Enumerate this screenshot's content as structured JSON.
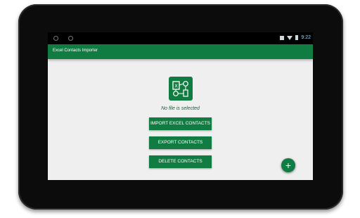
{
  "status_bar": {
    "time": "9:22",
    "left_icons": [
      "notification-icon",
      "notification-icon"
    ],
    "right_icons": [
      "sim-icon",
      "wifi-icon",
      "battery-icon"
    ]
  },
  "app_bar": {
    "title": "Excel Contacts Importer"
  },
  "main": {
    "logo_icon": "excel-contacts-logo-icon",
    "file_status": "No file is selected",
    "import_label": "IMPORT EXCEL CONTACTS",
    "export_label": "EXPORT CONTACTS",
    "delete_label": "DELETE CONTACTS"
  },
  "fab": {
    "symbol": "+",
    "icon": "add-icon"
  },
  "colors": {
    "accent": "#107c41",
    "screen_bg": "#efefef",
    "bezel": "#0c0c0c"
  }
}
